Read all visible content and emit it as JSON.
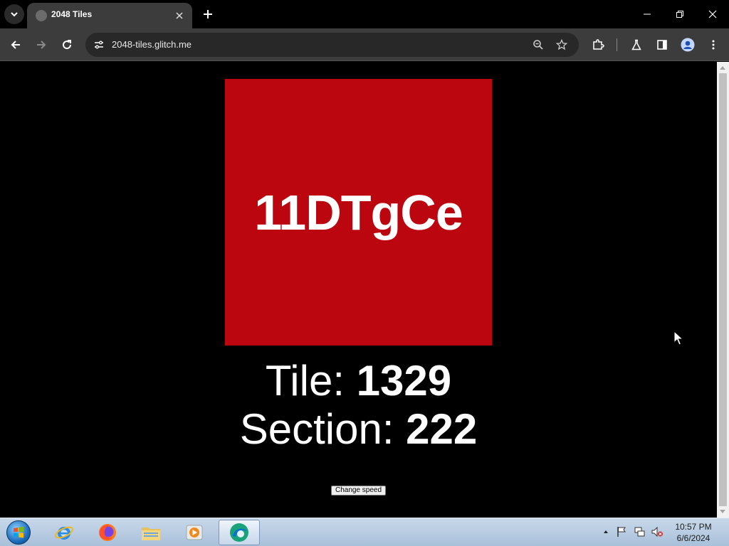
{
  "browser": {
    "tab": {
      "title": "2048 Tiles"
    },
    "address_bar": {
      "url": "2048-tiles.glitch.me"
    }
  },
  "page": {
    "tile": {
      "text": "11DTgCe",
      "color": "#bb0610"
    },
    "tile_stat": {
      "label": "Tile: ",
      "value": "1329"
    },
    "section_stat": {
      "label": "Section: ",
      "value": "222"
    },
    "change_speed_button": "Change speed"
  },
  "taskbar": {
    "apps": [
      "internet-explorer-icon",
      "firefox-icon",
      "file-explorer-icon",
      "media-player-icon",
      "browser-app-icon"
    ],
    "clock": {
      "time": "10:57 PM",
      "date": "6/6/2024"
    }
  }
}
